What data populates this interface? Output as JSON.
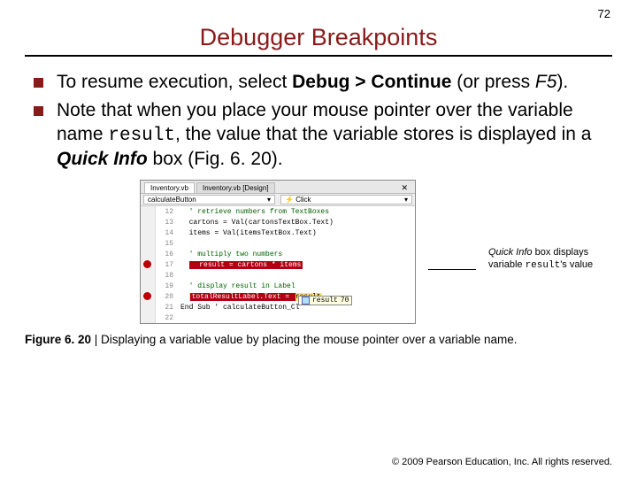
{
  "pageNumber": "72",
  "title": "Debugger Breakpoints",
  "bullets": {
    "b1": {
      "pre": "To resume execution, select ",
      "menu": "Debug > Continue",
      "mid": " (or press ",
      "key": "F5",
      "post": ")."
    },
    "b2": {
      "pre": "Note that when you place your mouse pointer over the variable name ",
      "var": "result",
      "mid": ", the value that the variable stores is displayed in a ",
      "term": "Quick Info",
      "post": " box (Fig. 6. 20)."
    }
  },
  "ide": {
    "tabs": {
      "active": "Inventory.vb",
      "inactive": "Inventory.vb [Design]",
      "close": "✕"
    },
    "dropdowns": {
      "left": "calculateButton",
      "right": "Click",
      "icon": "⚡"
    },
    "lines": {
      "l12": {
        "n": "12",
        "t": "  ' retrieve numbers from TextBoxes"
      },
      "l13": {
        "n": "13",
        "t": "  cartons = Val(cartonsTextBox.Text)"
      },
      "l14": {
        "n": "14",
        "t": "  items = Val(itemsTextBox.Text)"
      },
      "l15": {
        "n": "15",
        "t": ""
      },
      "l16": {
        "n": "16",
        "t": "  ' multiply two numbers"
      },
      "l17": {
        "n": "17",
        "t": "  result = cartons * items"
      },
      "l18": {
        "n": "18",
        "t": ""
      },
      "l19": {
        "n": "19",
        "t": "  ' display result in Label"
      },
      "l20_a": "  ",
      "l20_b": "totalResultLabel.Text = ",
      "l20_c": "result",
      "l20n": "20",
      "l21": {
        "n": "21",
        "t": "End Sub ' calculateButton_Cl"
      },
      "l22": {
        "n": "22",
        "t": ""
      }
    },
    "quickinfo": {
      "name": "result",
      "value": "70"
    }
  },
  "callout": {
    "l1a": "Quick Info",
    "l1b": " box displays variable ",
    "l2a": "result",
    "l2b": "'s value"
  },
  "figcap": {
    "label": "Figure 6. 20",
    "text": " | Displaying a variable value by placing the mouse pointer over a variable name."
  },
  "footer": {
    "sym": "©",
    "text": " 2009 Pearson Education, Inc.  All rights reserved."
  }
}
